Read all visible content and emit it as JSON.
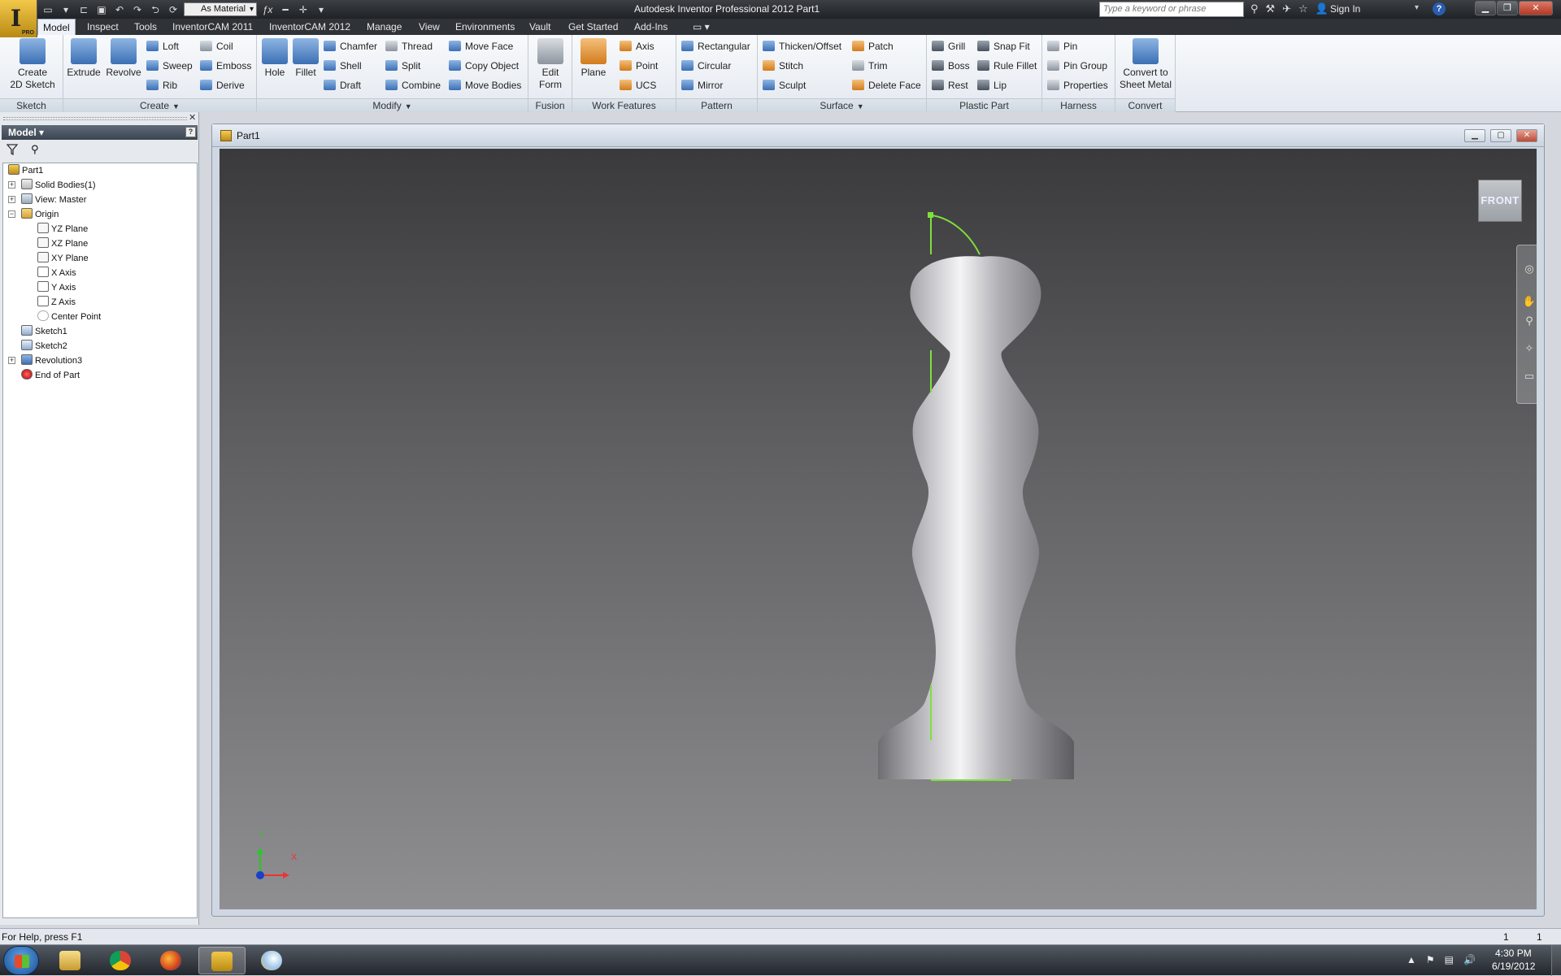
{
  "window": {
    "title": "Autodesk Inventor Professional 2012    Part1"
  },
  "qat": {
    "material": "As Material"
  },
  "help_search": {
    "placeholder": "Type a keyword or phrase"
  },
  "account": {
    "sign_in": "Sign In"
  },
  "ribbon_tabs": [
    "Model",
    "Inspect",
    "Tools",
    "InventorCAM 2011",
    "InventorCAM 2012",
    "Manage",
    "View",
    "Environments",
    "Vault",
    "Get Started",
    "Add-Ins"
  ],
  "ribbon": {
    "sketch": {
      "title": "Sketch",
      "create_sketch_line1": "Create",
      "create_sketch_line2": "2D Sketch"
    },
    "create": {
      "title": "Create",
      "extrude": "Extrude",
      "revolve": "Revolve",
      "loft": "Loft",
      "sweep": "Sweep",
      "rib": "Rib",
      "coil": "Coil",
      "emboss": "Emboss",
      "derive": "Derive"
    },
    "modify": {
      "title": "Modify",
      "hole": "Hole",
      "fillet": "Fillet",
      "chamfer": "Chamfer",
      "shell": "Shell",
      "draft": "Draft",
      "thread": "Thread",
      "split": "Split",
      "combine": "Combine",
      "move_face": "Move Face",
      "copy_object": "Copy Object",
      "move_bodies": "Move Bodies"
    },
    "fusion": {
      "title": "Fusion",
      "edit_form_line1": "Edit",
      "edit_form_line2": "Form"
    },
    "work_features": {
      "title": "Work Features",
      "plane": "Plane",
      "axis": "Axis",
      "point": "Point",
      "ucs": "UCS"
    },
    "pattern": {
      "title": "Pattern",
      "rectangular": "Rectangular",
      "circular": "Circular",
      "mirror": "Mirror"
    },
    "surface": {
      "title": "Surface",
      "thicken_offset": "Thicken/Offset",
      "stitch": "Stitch",
      "sculpt": "Sculpt",
      "patch": "Patch",
      "trim": "Trim",
      "delete_face": "Delete Face"
    },
    "plastic_part": {
      "title": "Plastic Part",
      "grill": "Grill",
      "boss": "Boss",
      "rest": "Rest",
      "snap_fit": "Snap Fit",
      "rule_fillet": "Rule Fillet",
      "lip": "Lip"
    },
    "harness": {
      "title": "Harness",
      "pin": "Pin",
      "pin_group": "Pin Group",
      "properties": "Properties"
    },
    "convert": {
      "title": "Convert",
      "convert_line1": "Convert to",
      "convert_line2": "Sheet Metal"
    }
  },
  "browser": {
    "header": "Model",
    "tree": [
      "Part1",
      "Solid Bodies(1)",
      "View: Master",
      "Origin",
      "YZ Plane",
      "XZ Plane",
      "XY Plane",
      "X Axis",
      "Y Axis",
      "Z Axis",
      "Center Point",
      "Sketch1",
      "Sketch2",
      "Revolution3",
      "End of Part"
    ]
  },
  "document": {
    "name": "Part1"
  },
  "viewcube": {
    "label": "FRONT"
  },
  "triad": {
    "x_label": "X",
    "y_label": "Y"
  },
  "status": {
    "help_text": "For Help, press F1",
    "count1": "1",
    "count2": "1"
  },
  "clock": {
    "time": "4:30 PM",
    "date": "6/19/2012"
  },
  "colors": {
    "sketch_green": "#7ee03a",
    "viewport_top": "#3a3a3c",
    "viewport_bottom": "#8f8f91"
  }
}
